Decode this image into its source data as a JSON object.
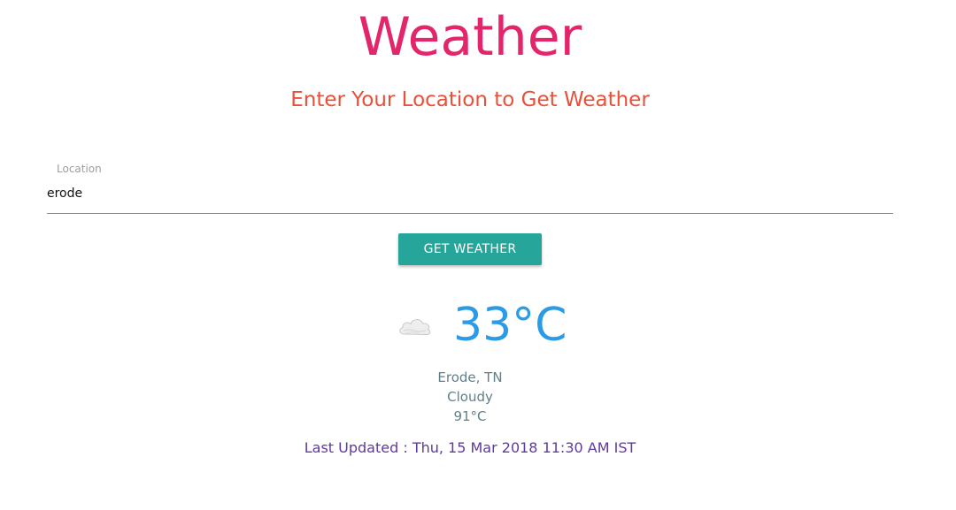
{
  "header": {
    "title": "Weather",
    "subtitle": "Enter Your Location to Get Weather"
  },
  "form": {
    "location_label": "Location",
    "location_value": "erode",
    "submit_label": "GET WEATHER"
  },
  "result": {
    "icon": "cloud-icon",
    "temperature": "33°C",
    "place": "Erode, TN",
    "condition": "Cloudy",
    "temperature_f": "91°C",
    "last_updated": "Last Updated : Thu, 15 Mar 2018 11:30 AM IST"
  },
  "colors": {
    "title": "#e3266b",
    "subtitle": "#e8503a",
    "button": "#26a69a",
    "temperature": "#2b9be8",
    "updated": "#5e3a9e"
  }
}
